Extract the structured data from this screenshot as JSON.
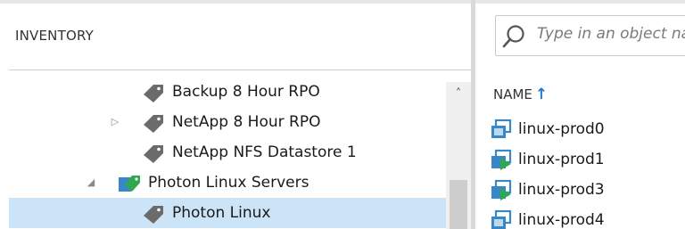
{
  "inventory": {
    "header": "INVENTORY",
    "tree": [
      {
        "label": "Backup 8 Hour RPO",
        "icon": "tag-icon",
        "expandable": false,
        "selected": false
      },
      {
        "label": "NetApp 8 Hour RPO",
        "icon": "tag-icon",
        "expandable": true,
        "expanded": false,
        "selected": false
      },
      {
        "label": "NetApp NFS Datastore 1",
        "icon": "tag-icon",
        "expandable": false,
        "selected": false
      },
      {
        "label": "Photon Linux Servers",
        "icon": "tag-category-icon",
        "expandable": true,
        "expanded": true,
        "selected": false
      },
      {
        "label": "Photon Linux",
        "icon": "tag-icon",
        "expandable": false,
        "selected": true
      }
    ]
  },
  "objects": {
    "search_placeholder": "Type in an object name",
    "column_header": "NAME",
    "sort": "ascending",
    "items": [
      {
        "name": "linux-prod0",
        "icon": "vm-stopped-icon"
      },
      {
        "name": "linux-prod1",
        "icon": "vm-running-icon"
      },
      {
        "name": "linux-prod3",
        "icon": "vm-running-icon"
      },
      {
        "name": "linux-prod4",
        "icon": "vm-stopped-icon"
      }
    ]
  },
  "colors": {
    "selection": "#cce4f7",
    "accent": "#1c7cd6",
    "tag_gray": "#6b6b6b",
    "vm_blue": "#3a87c8",
    "run_green": "#2fa84f"
  }
}
